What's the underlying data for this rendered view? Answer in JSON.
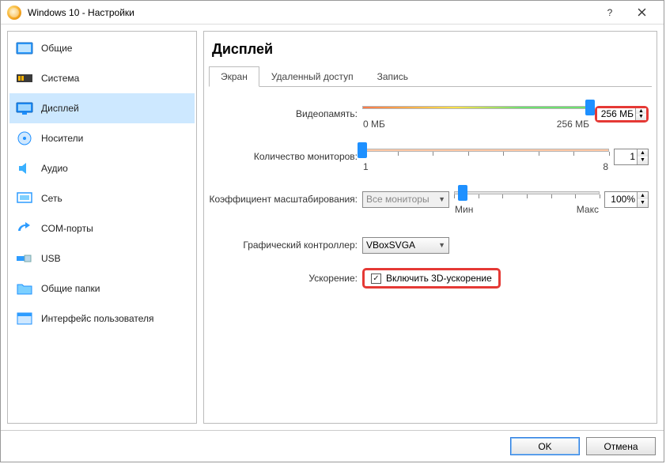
{
  "title": "Windows 10 - Настройки",
  "sidebar": {
    "items": [
      {
        "label": "Общие",
        "icon": "general"
      },
      {
        "label": "Система",
        "icon": "system"
      },
      {
        "label": "Дисплей",
        "icon": "display",
        "selected": true
      },
      {
        "label": "Носители",
        "icon": "storage"
      },
      {
        "label": "Аудио",
        "icon": "audio"
      },
      {
        "label": "Сеть",
        "icon": "network"
      },
      {
        "label": "COM-порты",
        "icon": "com"
      },
      {
        "label": "USB",
        "icon": "usb"
      },
      {
        "label": "Общие папки",
        "icon": "folders"
      },
      {
        "label": "Интерфейс пользователя",
        "icon": "ui"
      }
    ]
  },
  "content": {
    "title": "Дисплей",
    "tabs": [
      {
        "label": "Экран",
        "active": true
      },
      {
        "label": "Удаленный доступ"
      },
      {
        "label": "Запись"
      }
    ],
    "video_memory": {
      "label": "Видеопамять:",
      "value": "256 МБ",
      "min": "0 МБ",
      "max": "256 МБ",
      "pos": 100
    },
    "monitors": {
      "label": "Количество мониторов:",
      "value": "1",
      "min": "1",
      "max": "8",
      "pos": 0
    },
    "scale": {
      "label": "Коэффициент масштабирования:",
      "combo": "Все мониторы",
      "value": "100%",
      "min": "Мин",
      "max": "Макс",
      "pos": 10
    },
    "controller": {
      "label": "Графический контроллер:",
      "value": "VBoxSVGA"
    },
    "accel": {
      "label": "Ускорение:",
      "checkbox": "Включить 3D-ускорение",
      "checked": true
    }
  },
  "buttons": {
    "ok": "OK",
    "cancel": "Отмена"
  }
}
